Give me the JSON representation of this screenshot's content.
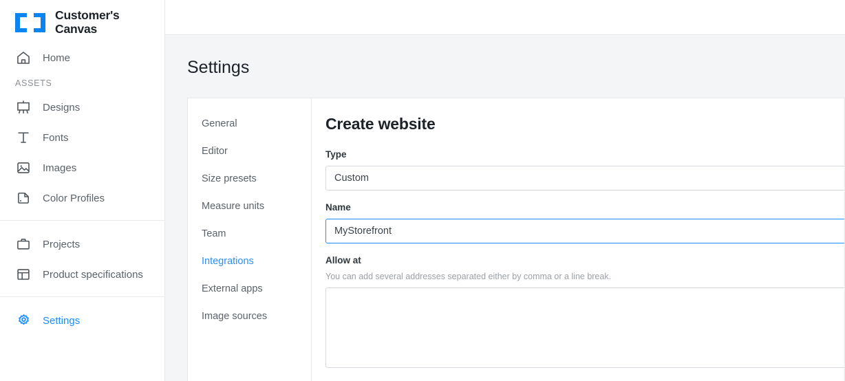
{
  "brand": {
    "logo_line1": "Customer's",
    "logo_line2": "Canvas",
    "logo_color": "#0a84f0",
    "accent_color": "#1a8cff"
  },
  "sidebar": {
    "primary": [
      {
        "label": "Home",
        "icon": "home-icon",
        "active": false
      }
    ],
    "assets_group_label": "ASSETS",
    "assets": [
      {
        "label": "Designs",
        "icon": "easel-icon",
        "active": false
      },
      {
        "label": "Fonts",
        "icon": "text-t-icon",
        "active": false
      },
      {
        "label": "Images",
        "icon": "image-icon",
        "active": false
      },
      {
        "label": "Color Profiles",
        "icon": "color-profile-icon",
        "active": false
      }
    ],
    "projects": [
      {
        "label": "Projects",
        "icon": "briefcase-icon",
        "active": false
      },
      {
        "label": "Product specifications",
        "icon": "layout-icon",
        "active": false
      }
    ],
    "footer": [
      {
        "label": "Settings",
        "icon": "gear-icon",
        "active": true
      }
    ]
  },
  "page": {
    "title": "Settings"
  },
  "subnav": {
    "items": [
      {
        "label": "General",
        "active": false
      },
      {
        "label": "Editor",
        "active": false
      },
      {
        "label": "Size presets",
        "active": false
      },
      {
        "label": "Measure units",
        "active": false
      },
      {
        "label": "Team",
        "active": false
      },
      {
        "label": "Integrations",
        "active": true
      },
      {
        "label": "External apps",
        "active": false
      },
      {
        "label": "Image sources",
        "active": false
      }
    ]
  },
  "form": {
    "heading": "Create website",
    "type": {
      "label": "Type",
      "value": "Custom",
      "focused": false
    },
    "name": {
      "label": "Name",
      "value": "MyStorefront",
      "focused": true
    },
    "allow_at": {
      "label": "Allow at",
      "hint": "You can add several addresses separated either by comma or a line break.",
      "value": ""
    }
  }
}
